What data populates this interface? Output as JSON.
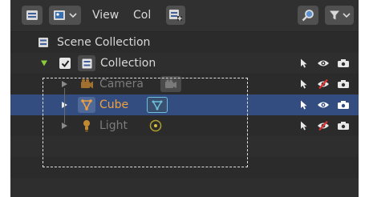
{
  "header": {
    "view_label": "View",
    "col_label": "Col"
  },
  "outliner": {
    "scene_collection": {
      "label": "Scene Collection"
    },
    "collection": {
      "label": "Collection",
      "checked": true
    },
    "objects": [
      {
        "label": "Camera",
        "type": "camera",
        "selected": false,
        "visible": false
      },
      {
        "label": "Cube",
        "type": "mesh",
        "selected": true,
        "visible": true
      },
      {
        "label": "Light",
        "type": "light",
        "selected": false,
        "visible": false
      }
    ]
  },
  "colors": {
    "selection": "#334d80",
    "collection_icon": "#6aa0e6",
    "object_icon": "#f0a040",
    "data_icon": "#6ec0d8",
    "light_data_icon": "#d8c040",
    "disabled_eye": "#e03030",
    "expand_arrow": "#8acc3a"
  }
}
